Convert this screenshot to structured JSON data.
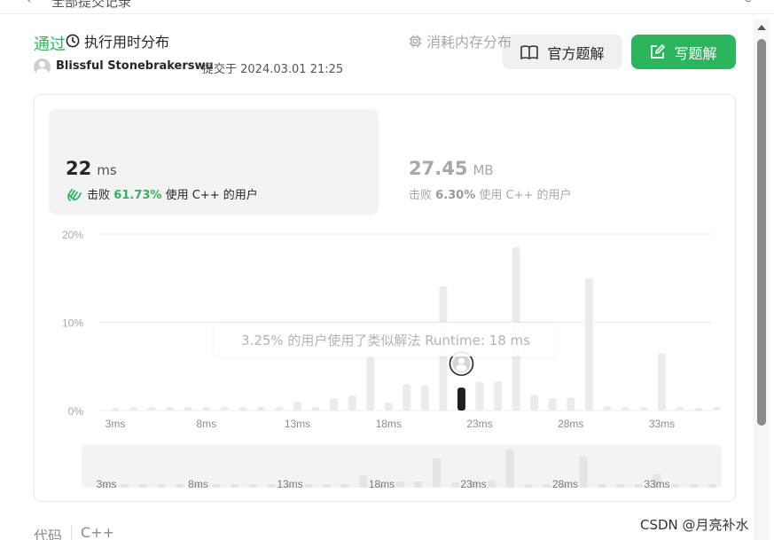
{
  "topbar": {
    "back_glyph": "‹",
    "title": "全部提交记录",
    "corner_glyph": "⟳"
  },
  "submission": {
    "status": "通过",
    "author": "Blissful Stonebrakerswu",
    "submitted_text": "提交于 2024.03.01 21:25"
  },
  "buttons": {
    "official": "官方题解",
    "write": "写题解"
  },
  "runtime": {
    "title": "执行用时分布",
    "value": "22",
    "unit": "ms",
    "beat_prefix": "击败",
    "beat_pct": "61.73%",
    "beat_suffix": "使用 C++ 的用户"
  },
  "memory": {
    "title": "消耗内存分布",
    "value": "27.45",
    "unit": "MB",
    "beat_prefix": "击败",
    "beat_pct": "6.30%",
    "beat_suffix": "使用 C++ 的用户"
  },
  "tooltip": "3.25% 的用户使用了类似解法 Runtime: 18 ms",
  "chart_data": {
    "type": "bar",
    "ylabel": "",
    "xlabel": "",
    "ylim": [
      0,
      20
    ],
    "yticks": [
      "20%",
      "10%",
      "0%"
    ],
    "xticks": [
      "3ms",
      "8ms",
      "13ms",
      "18ms",
      "23ms",
      "28ms",
      "33ms"
    ],
    "x": [
      3,
      4,
      5,
      6,
      7,
      8,
      9,
      10,
      11,
      12,
      13,
      14,
      15,
      16,
      17,
      18,
      19,
      20,
      21,
      22,
      23,
      24,
      25,
      26,
      27,
      28,
      29,
      30,
      31,
      32,
      33,
      34,
      35,
      36
    ],
    "values": [
      0.3,
      0.4,
      0.4,
      0.4,
      0.4,
      0.4,
      0.4,
      0.4,
      0.4,
      0.4,
      1.0,
      0.4,
      1.4,
      1.7,
      6.0,
      0.9,
      3.0,
      2.9,
      14.1,
      2.6,
      3.25,
      3.3,
      18.5,
      1.8,
      1.4,
      1.5,
      15.0,
      0.5,
      0.4,
      0.4,
      6.5,
      0.4,
      0.3,
      0.4
    ],
    "highlight_x": 22,
    "highlight_color": "#1f1f1f",
    "bar_color": "#ebebeb",
    "navigator_xticks": [
      "3ms",
      "8ms",
      "13ms",
      "18ms",
      "23ms",
      "28ms",
      "33ms"
    ]
  },
  "code": {
    "label": "代码",
    "language": "C++"
  },
  "watermark": "CSDN @月亮补水",
  "colors": {
    "accent": "#2db55d",
    "muted": "#a8a8a8"
  }
}
